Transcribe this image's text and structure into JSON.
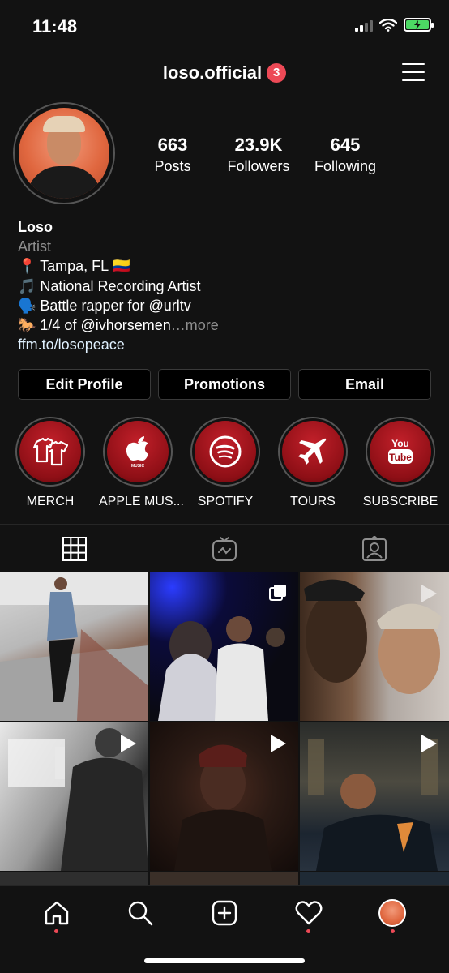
{
  "status_bar": {
    "time": "11:48"
  },
  "header": {
    "username": "loso.official",
    "notification_count": "3"
  },
  "profile": {
    "stats": [
      {
        "value": "663",
        "label": "Posts"
      },
      {
        "value": "23.9K",
        "label": "Followers"
      },
      {
        "value": "645",
        "label": "Following"
      }
    ],
    "name": "Loso",
    "category": "Artist",
    "bio_lines": [
      "📍 Tampa, FL 🇨🇴",
      "🎵 National Recording Artist",
      "🗣️ Battle rapper for @urltv"
    ],
    "bio_last_line": "🐎 1/4 of @ivhorsemen",
    "bio_ellipsis": "…",
    "more_label": "more",
    "link": "ffm.to/losopeace"
  },
  "buttons": {
    "edit_profile": "Edit Profile",
    "promotions": "Promotions",
    "email": "Email"
  },
  "highlights": [
    {
      "label": "MERCH",
      "icon": "shirt-icon"
    },
    {
      "label": "APPLE MUS...",
      "icon": "apple-music-icon"
    },
    {
      "label": "SPOTIFY",
      "icon": "spotify-icon"
    },
    {
      "label": "TOURS",
      "icon": "airplane-icon"
    },
    {
      "label": "SUBSCRIBE",
      "icon": "youtube-icon"
    }
  ],
  "tabs": [
    {
      "icon": "grid-icon",
      "active": true
    },
    {
      "icon": "igtv-icon",
      "active": false
    },
    {
      "icon": "tagged-icon",
      "active": false
    }
  ],
  "posts": [
    {
      "type": "photo"
    },
    {
      "type": "carousel"
    },
    {
      "type": "video"
    },
    {
      "type": "video"
    },
    {
      "type": "video"
    },
    {
      "type": "video"
    }
  ],
  "bottom_nav": [
    {
      "icon": "home-icon",
      "has_dot": true
    },
    {
      "icon": "search-icon",
      "has_dot": false
    },
    {
      "icon": "add-post-icon",
      "has_dot": false
    },
    {
      "icon": "heart-icon",
      "has_dot": true
    },
    {
      "icon": "profile-avatar",
      "has_dot": true
    }
  ],
  "colors": {
    "background": "#121212",
    "badge": "#ed4956",
    "highlight_red": "#c2202a",
    "battery": "#4cd964"
  }
}
